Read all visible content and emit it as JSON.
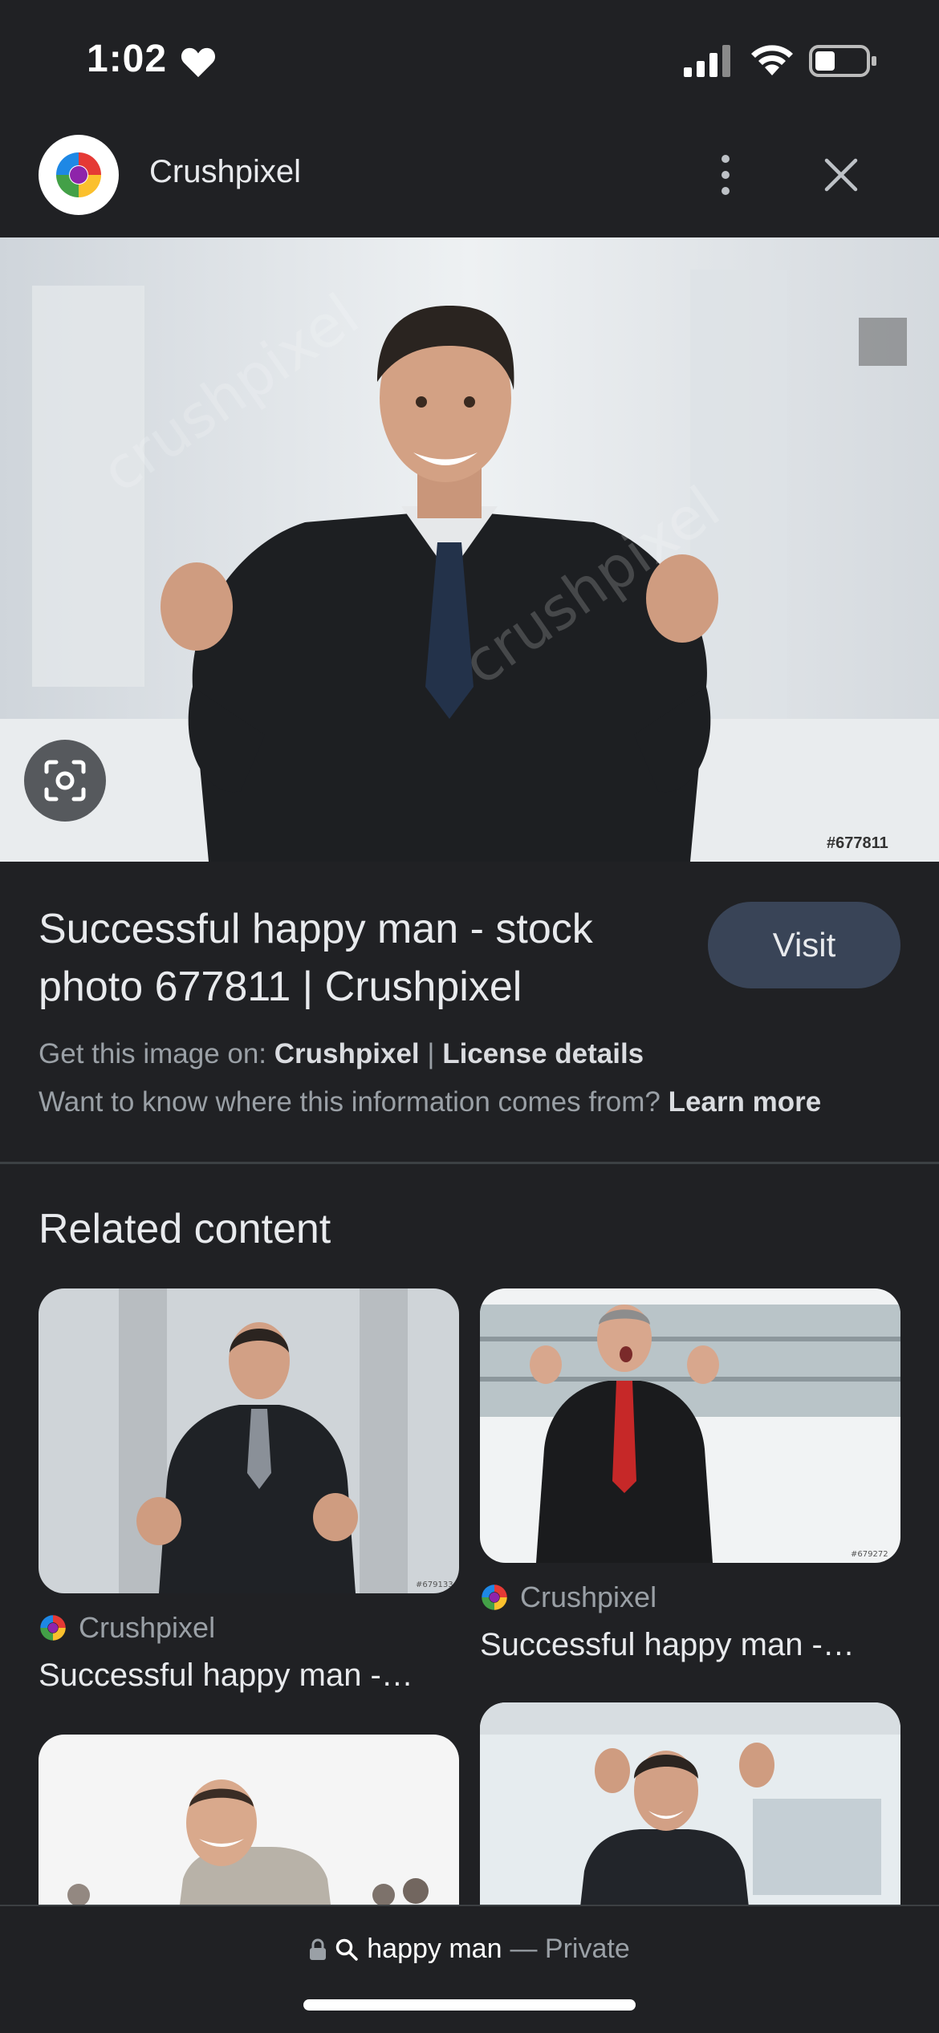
{
  "status_bar": {
    "time": "1:02",
    "heart_icon": "heart-icon",
    "signal_icon": "cellular-signal-icon",
    "wifi_icon": "wifi-icon",
    "battery_icon": "battery-icon",
    "battery_level": 0.35
  },
  "header": {
    "site_name": "Crushpixel",
    "logo_icon": "crushpixel-logo-icon",
    "more_icon": "more-vertical-icon",
    "close_icon": "close-icon"
  },
  "image": {
    "id_label": "#677811",
    "lens_icon": "lens-search-icon"
  },
  "result": {
    "title_line1": "Successful happy man - stock",
    "title_line2": "photo 677811 | Crushpixel",
    "visit_label": "Visit",
    "get_image_prefix": "Get this image on: ",
    "get_image_source": "Crushpixel",
    "separator": " | ",
    "license_label": "License details",
    "info_question": "Want to know where this information comes from? ",
    "learn_more": "Learn more"
  },
  "related": {
    "heading": "Related content",
    "cards": [
      {
        "source": "Crushpixel",
        "title": "Successful happy man -…",
        "id": "#679133"
      },
      {
        "source": "Crushpixel",
        "title": "Successful happy man -…",
        "id": "#679272"
      }
    ]
  },
  "bottom_bar": {
    "lock_icon": "lock-icon",
    "search_icon": "search-icon",
    "query": "happy man",
    "mode": "— Private"
  },
  "colors": {
    "background": "#202124",
    "visit_button": "#394457",
    "text_primary": "#e8eaed",
    "text_secondary": "#9aa0a6"
  }
}
